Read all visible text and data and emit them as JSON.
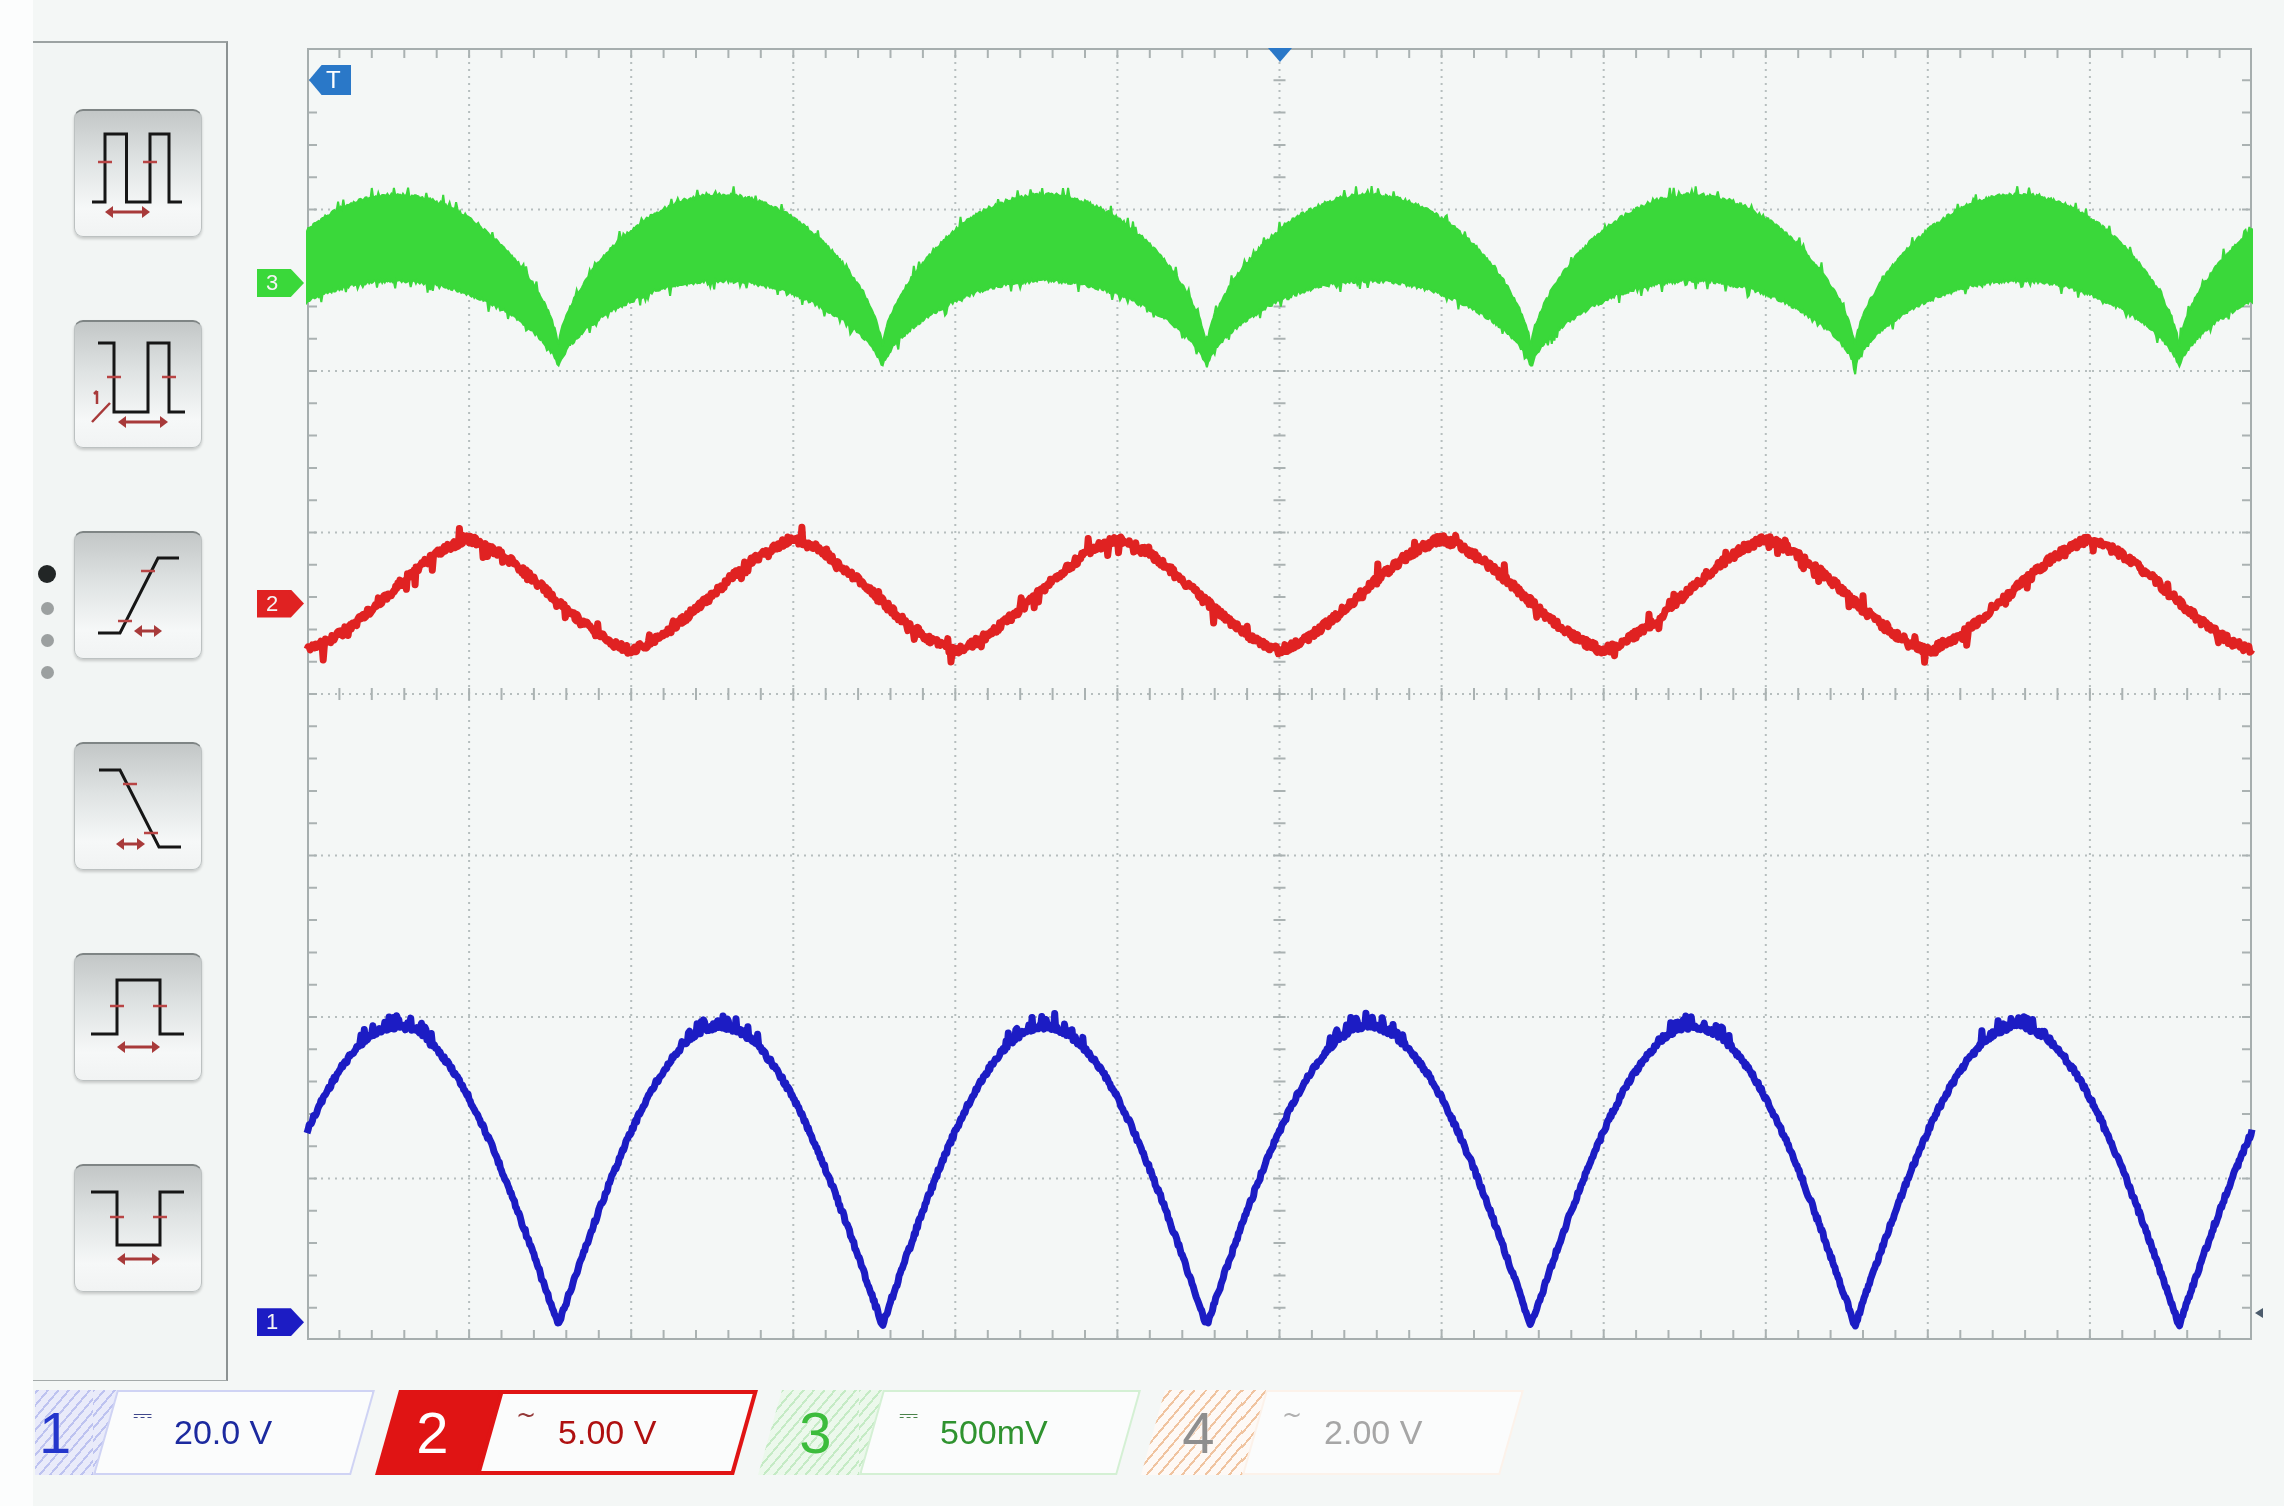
{
  "sidebar": {
    "measure_buttons": [
      {
        "kind": "period"
      },
      {
        "kind": "frequency"
      },
      {
        "kind": "rise_time"
      },
      {
        "kind": "fall_time"
      },
      {
        "kind": "positive_width"
      },
      {
        "kind": "negative_width"
      }
    ],
    "page_dots": [
      {
        "selected": true
      },
      {
        "selected": false
      },
      {
        "selected": false
      },
      {
        "selected": false
      }
    ]
  },
  "scope": {
    "trigger": {
      "label": "T"
    },
    "traces": [
      {
        "marker": "3",
        "color": "#3ad83a",
        "kind": "noise_band"
      },
      {
        "marker": "2",
        "color": "#e02222",
        "kind": "triangle"
      },
      {
        "marker": "1",
        "color": "#1c1cc4",
        "kind": "rectified"
      }
    ]
  },
  "channels": [
    {
      "number": "1",
      "coupling": "⎓",
      "scale": "20.0 V",
      "color": "#2436cc",
      "selected": false,
      "enabled": true
    },
    {
      "number": "2",
      "coupling": "~",
      "scale": "5.00 V",
      "color": "#e01414",
      "selected": true,
      "enabled": true
    },
    {
      "number": "3",
      "coupling": "⎓",
      "scale": "500mV",
      "color": "#3cbc3c",
      "selected": false,
      "enabled": true
    },
    {
      "number": "4",
      "coupling": "~",
      "scale": "2.00 V",
      "color": "#f0c4a0",
      "selected": false,
      "enabled": false
    }
  ]
}
